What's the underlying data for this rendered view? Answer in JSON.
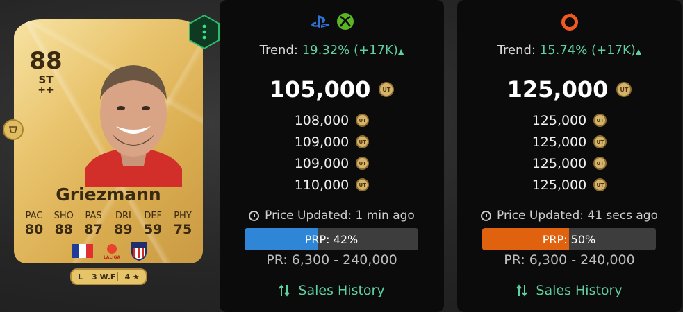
{
  "card": {
    "rating": "88",
    "position": "ST",
    "plus": "++",
    "name": "Griezmann",
    "stats": [
      {
        "label": "PAC",
        "value": "80"
      },
      {
        "label": "SHO",
        "value": "88"
      },
      {
        "label": "PAS",
        "value": "87"
      },
      {
        "label": "DRI",
        "value": "89"
      },
      {
        "label": "DEF",
        "value": "59"
      },
      {
        "label": "PHY",
        "value": "75"
      }
    ],
    "attributes": [
      "L",
      "3 W.F",
      "4 ★"
    ],
    "league_text": "LALIGA",
    "icons": {
      "nation": "france-flag-icon",
      "league": "laliga-logo-icon",
      "club": "atletico-madrid-crest-icon"
    }
  },
  "panels": [
    {
      "platform_icons": [
        "playstation-icon",
        "xbox-icon"
      ],
      "trend_label": "Trend:",
      "trend_value": "19.32% (+17K)",
      "main_price": "105,000",
      "prices": [
        "108,000",
        "109,000",
        "109,000",
        "110,000"
      ],
      "updated": "Price Updated: 1 min ago",
      "prp_label": "PRP: 42%",
      "prp_percent": 42,
      "prp_color": "#2f86d6",
      "pr_range": "PR: 6,300 - 240,000",
      "sales_label": "Sales History"
    },
    {
      "platform_icons": [
        "origin-icon"
      ],
      "trend_label": "Trend:",
      "trend_value": "15.74% (+17K)",
      "main_price": "125,000",
      "prices": [
        "125,000",
        "125,000",
        "125,000",
        "125,000"
      ],
      "updated": "Price Updated: 41 secs ago",
      "prp_label": "PRP: 50%",
      "prp_percent": 50,
      "prp_color": "#e0620f",
      "pr_range": "PR: 6,300 - 240,000",
      "sales_label": "Sales History"
    }
  ],
  "colors": {
    "accent_green": "#5fd0a0",
    "card_gold": "#e9c46e"
  }
}
